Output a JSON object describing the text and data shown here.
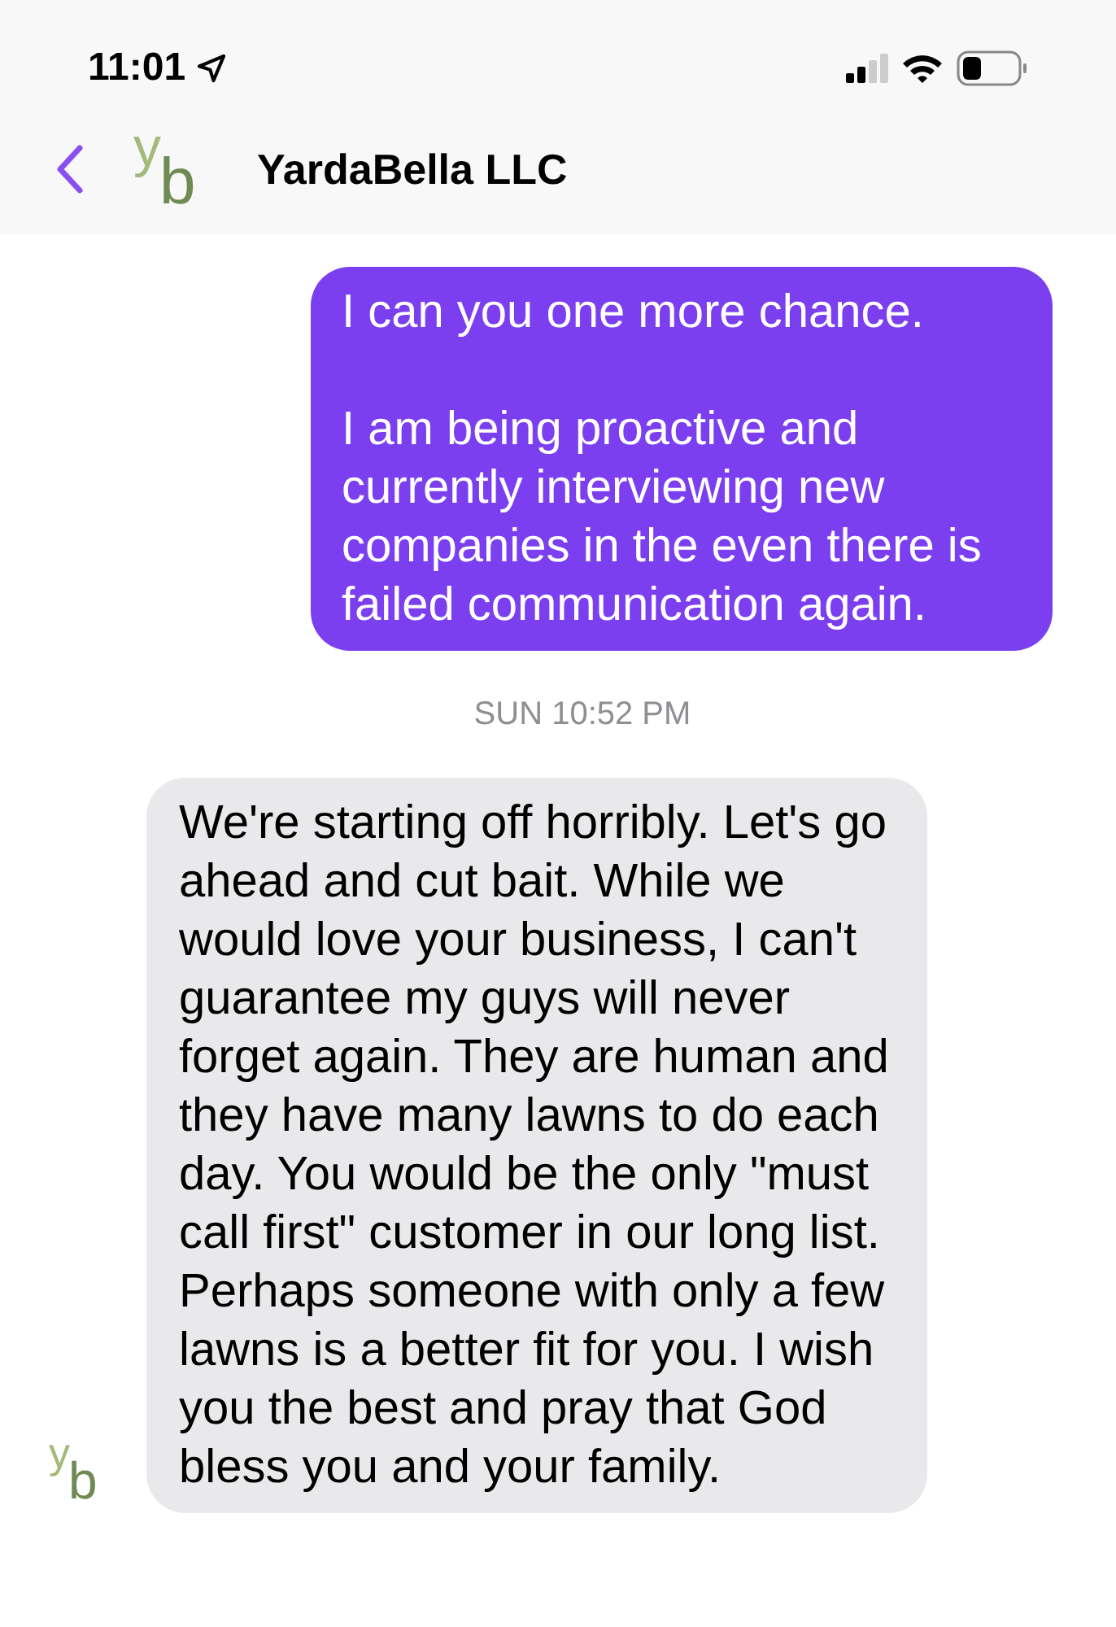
{
  "status_bar": {
    "time": "11:01"
  },
  "header": {
    "avatar": {
      "letter_1": "y",
      "letter_2": "b"
    },
    "title": "YardaBella LLC"
  },
  "messages": [
    {
      "kind": "outgoing",
      "paragraphs": [
        "I can you one more chance.",
        "I am being proactive and currently interviewing new companies in the even there is failed communication again."
      ]
    },
    {
      "kind": "timestamp",
      "text": "SUN 10:52 PM"
    },
    {
      "kind": "incoming",
      "avatar": {
        "letter_1": "y",
        "letter_2": "b"
      },
      "paragraphs": [
        "We're starting off horribly. Let's go ahead and cut bait. While we would love your business, I can't guarantee my guys will never forget again. They are human and they have many lawns to do each day. You would be the only \"must call first\" customer in our long list. Perhaps someone with only a few lawns is a better fit for you. I wish you the best and pray that God bless you and your family."
      ]
    }
  ]
}
